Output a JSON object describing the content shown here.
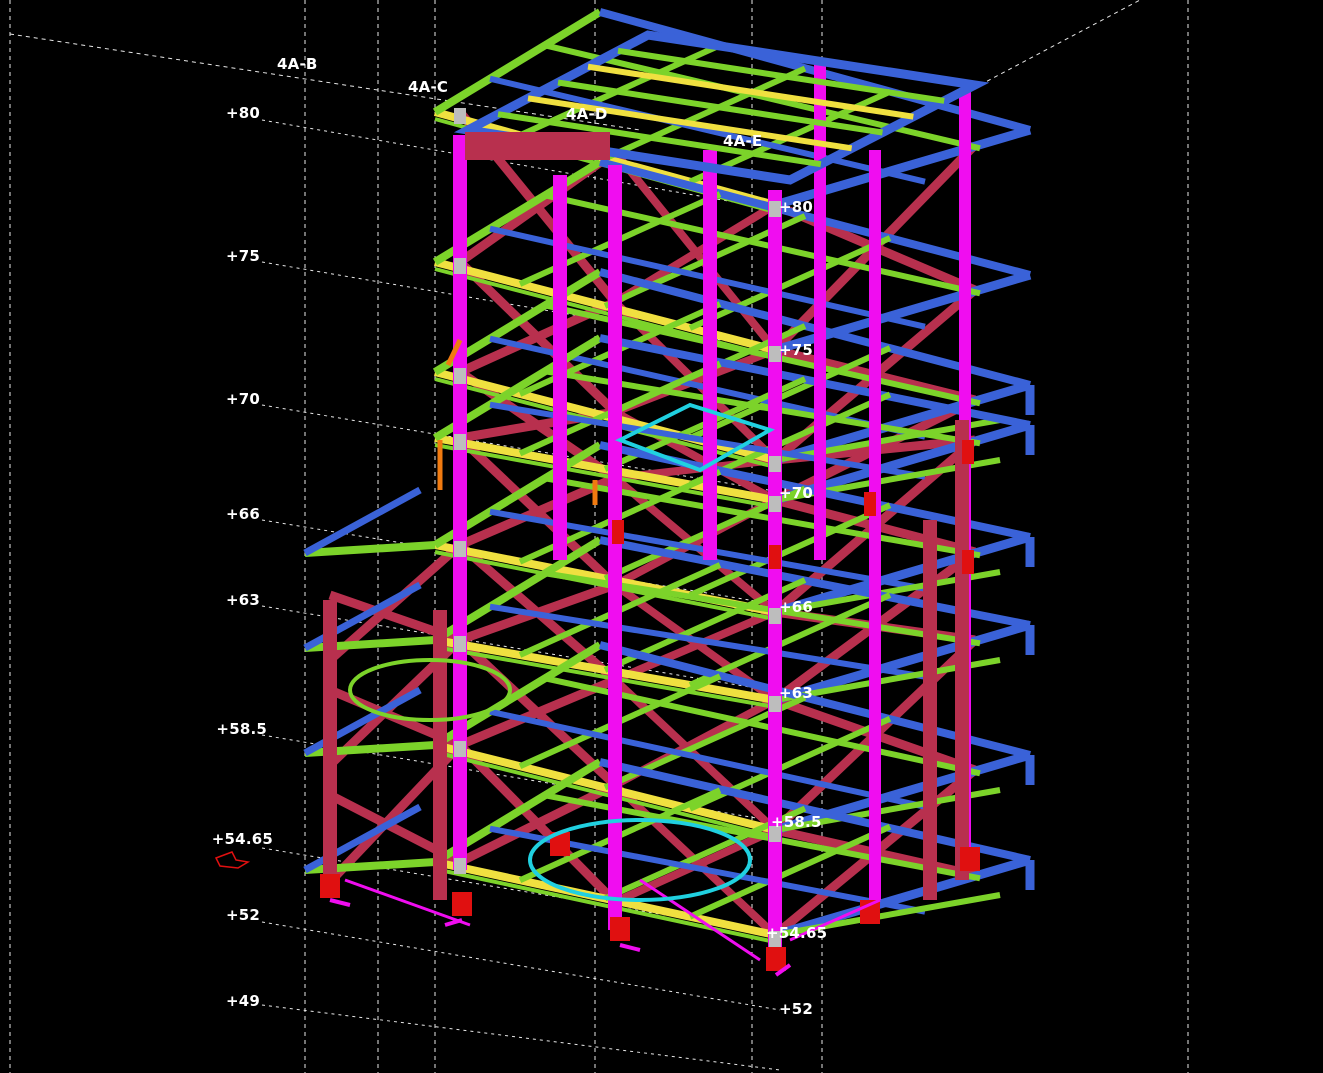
{
  "viewport": {
    "background": "#000000",
    "grid_line_color": "#e8e8e8",
    "grid_labels": [
      "4A-B",
      "4A-C",
      "4A-D",
      "4A-E"
    ],
    "left_levels": [
      "+80",
      "+75",
      "+70",
      "+66",
      "+63",
      "+58.5",
      "+54.65",
      "+52",
      "+49"
    ],
    "right_levels": [
      "+80",
      "+75",
      "+70",
      "+66",
      "+63",
      "+58.5",
      "+54.65",
      "+52"
    ]
  },
  "colors": {
    "column": "#f00df0",
    "brace": "#b8304e",
    "beam_primary": "#3a62d8",
    "beam_secondary": "#7cd32a",
    "beam_highlight": "#f0e040",
    "base_plate": "#e01010",
    "connection": "#bdbdbd",
    "accent_orange": "#f07a10",
    "accent_cyan": "#20d0e0"
  },
  "icons": {
    "view_marker": "view-direction-icon"
  }
}
